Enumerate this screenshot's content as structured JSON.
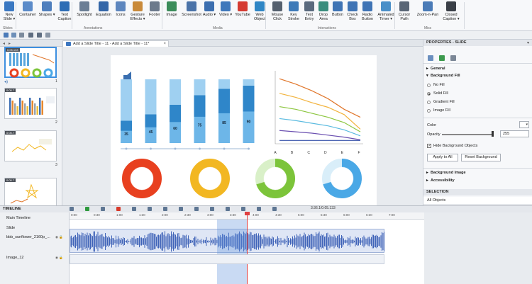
{
  "ribbon": {
    "buttons": [
      {
        "label": "New\nSlide ▾",
        "icon": "new-slide-icon",
        "color": "#3a78c2"
      },
      {
        "label": "Container",
        "icon": "container-icon",
        "color": "#5b8bc9"
      },
      {
        "label": "Shapes ▾",
        "icon": "shapes-icon",
        "color": "#4f7fbd"
      },
      {
        "label": "Text\nCaption",
        "icon": "text-caption-icon",
        "color": "#2d6db5"
      },
      {
        "label": "Spotlight",
        "icon": "spotlight-icon",
        "color": "#6b7e95"
      },
      {
        "label": "Equation",
        "icon": "equation-icon",
        "color": "#3466a8"
      },
      {
        "label": "Icons",
        "icon": "icons-icon",
        "color": "#5d86be"
      },
      {
        "label": "Gesture\nEffects ▾",
        "icon": "gesture-icon",
        "color": "#c98a3a"
      },
      {
        "label": "Footer",
        "icon": "footer-icon",
        "color": "#6c7a8c"
      },
      {
        "label": "Image",
        "icon": "image-icon",
        "color": "#3b8c5a"
      },
      {
        "label": "Screenshot",
        "icon": "screenshot-icon",
        "color": "#4b73a8"
      },
      {
        "label": "Audio ▾",
        "icon": "audio-icon",
        "color": "#3c6fb0"
      },
      {
        "label": "Video ▾",
        "icon": "video-icon",
        "color": "#3f78bb"
      },
      {
        "label": "YouTube",
        "icon": "youtube-icon",
        "color": "#d53b32"
      },
      {
        "label": "Web\nObject",
        "icon": "web-object-icon",
        "color": "#2f86c5"
      },
      {
        "label": "Mouse\nClick",
        "icon": "mouse-click-icon",
        "color": "#55606e"
      },
      {
        "label": "Key\nStroke",
        "icon": "key-stroke-icon",
        "color": "#3e7ab8"
      },
      {
        "label": "Text\nEntry",
        "icon": "text-entry-icon",
        "color": "#5a6a7e"
      },
      {
        "label": "Drop\nArea",
        "icon": "drop-area-icon",
        "color": "#3a8d7d"
      },
      {
        "label": "Button",
        "icon": "button-icon",
        "color": "#3f74b5"
      },
      {
        "label": "Check\nBox",
        "icon": "check-box-icon",
        "color": "#3f74b5"
      },
      {
        "label": "Radio\nButton",
        "icon": "radio-button-icon",
        "color": "#3f74b5"
      },
      {
        "label": "Animated\nTimer ▾",
        "icon": "timer-icon",
        "color": "#4a8fc8"
      },
      {
        "label": "Cursor\nPath",
        "icon": "cursor-path-icon",
        "color": "#5a6676"
      },
      {
        "label": "Zoom-n-Pan",
        "icon": "zoom-pan-icon",
        "color": "#4a7bb7"
      },
      {
        "label": "Closed\nCaption ▾",
        "icon": "closed-caption-icon",
        "color": "#3a3f47"
      }
    ],
    "groups": [
      "Slides",
      "Annotations",
      "Media",
      "Interactions",
      "Misc"
    ]
  },
  "tabs": [
    "Add a Slide Title - 11 - Add a Slide Title - 11*"
  ],
  "slides": [
    {
      "duration": "0:05.133",
      "number": "1"
    },
    {
      "duration": "0:05.7",
      "number": "2"
    },
    {
      "duration": "0:05.7",
      "number": "3"
    },
    {
      "duration": "0:05.7",
      "number": "4"
    }
  ],
  "chart_data": [
    {
      "type": "bar",
      "categories": [
        "1",
        "2",
        "3",
        "4",
        "5",
        "6"
      ],
      "values": [
        35,
        45,
        60,
        75,
        85,
        90
      ],
      "ylim": [
        0,
        100
      ]
    },
    {
      "type": "line",
      "categories": [
        "A",
        "B",
        "C",
        "D",
        "E",
        "F"
      ],
      "series": [
        {
          "values": [
            98,
            90,
            80,
            68,
            52,
            40
          ],
          "color": "#e0762b"
        },
        {
          "values": [
            76,
            70,
            62,
            55,
            44,
            22
          ],
          "color": "#f2b33d"
        },
        {
          "values": [
            56,
            52,
            46,
            40,
            32,
            18
          ],
          "color": "#8cc63f"
        },
        {
          "values": [
            38,
            35,
            31,
            27,
            21,
            12
          ],
          "color": "#5bbbe0"
        },
        {
          "values": [
            20,
            18,
            16,
            13,
            10,
            6
          ],
          "color": "#6a4fb0"
        },
        {
          "values": [
            5,
            5,
            5,
            5,
            5,
            5
          ],
          "color": "#3550a8"
        }
      ],
      "ylim": [
        0,
        110
      ]
    },
    {
      "type": "pie",
      "values": [
        100
      ],
      "color": "#e8401f"
    },
    {
      "type": "pie",
      "values": [
        100
      ],
      "color": "#f2b722"
    },
    {
      "type": "pie",
      "values": [
        70,
        30
      ],
      "color": "#7cc43a"
    },
    {
      "type": "pie",
      "values": [
        70,
        30
      ],
      "color": "#4aa8e6"
    }
  ],
  "properties": {
    "header": "PROPERTIES - SLIDE",
    "general": "General",
    "background_fill": "Background Fill",
    "fill_options": [
      "No Fill",
      "Solid Fill",
      "Gradient Fill",
      "Image Fill"
    ],
    "selected_fill": "Solid Fill",
    "color_label": "Color",
    "opacity_label": "Opacity",
    "opacity_value": "255",
    "hide_bg": "Hide Background Objects",
    "apply_all": "Apply to All",
    "reset_bg": "Reset Background",
    "background_image": "Background Image",
    "accessibility": "Accessibility"
  },
  "selection": {
    "header": "SELECTION",
    "items": [
      "All Objects",
      "bbb_sunflower_2160p_60fps_normal",
      "Image_12"
    ]
  },
  "timeline": {
    "header": "TIMELINE",
    "rows": [
      "Main Timeline",
      "Slide",
      "bbb_sunflower_2160p_...",
      "Image_12"
    ],
    "ticks": [
      "0:00",
      "0:30",
      "1:00",
      "1:30",
      "2:00",
      "2:30",
      "3:00",
      "3:30",
      "4:00",
      "4:30",
      "5:00",
      "5:30",
      "6:00",
      "6:30",
      "7:00"
    ],
    "current_time": "3:36.1/0:05.133"
  }
}
